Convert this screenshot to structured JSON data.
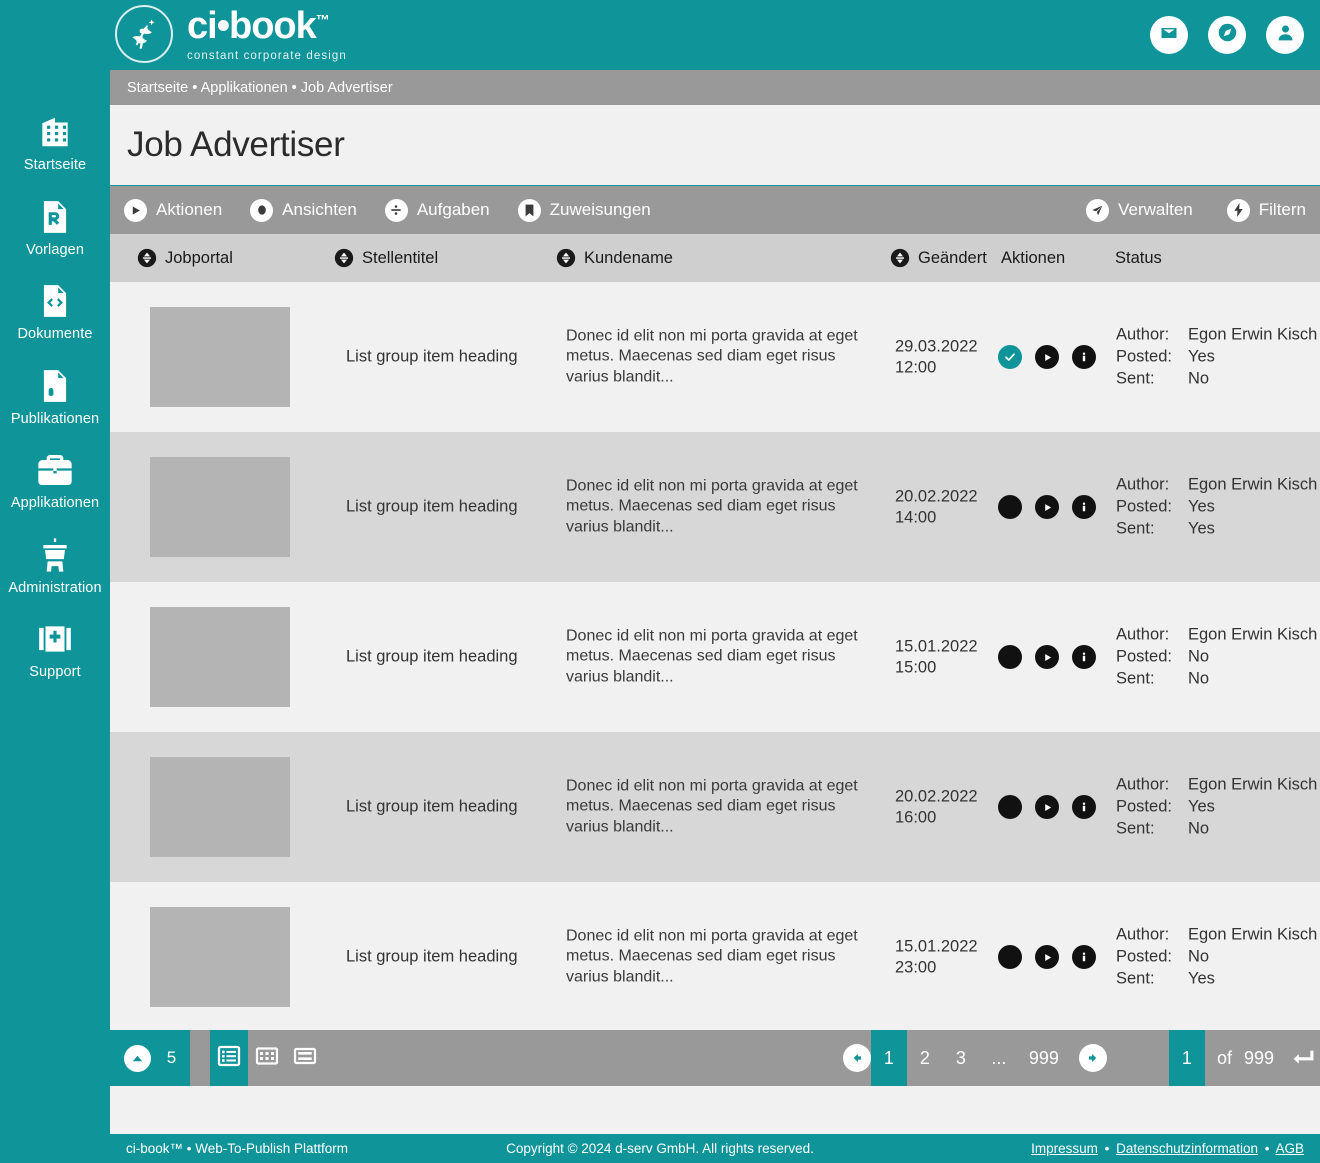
{
  "brand": {
    "logo_main": "ci•book",
    "logo_tm": "™",
    "logo_sub": "constant corporate design",
    "accent_color": "#0e9499",
    "toolbar_gray": "#999999",
    "header_gray": "#cfcfcf",
    "row_odd": "#f1f1f1",
    "row_even": "#d7d7d7",
    "thumb_color": "#b4b4b4"
  },
  "header": {
    "icons": [
      {
        "name": "mail-icon",
        "label": "Nachrichten"
      },
      {
        "name": "compass-icon",
        "label": "Navigation"
      },
      {
        "name": "user-icon",
        "label": "Benutzerkonto"
      }
    ]
  },
  "breadcrumb": {
    "text": "Startseite • Applikationen • Job Advertiser"
  },
  "page": {
    "title": "Job Advertiser"
  },
  "sidebar": {
    "items": [
      {
        "label": "Startseite",
        "icon": "building-icon"
      },
      {
        "label": "Vorlagen",
        "icon": "prescription-document-icon"
      },
      {
        "label": "Dokumente",
        "icon": "code-document-icon"
      },
      {
        "label": "Publikationen",
        "icon": "publication-document-icon"
      },
      {
        "label": "Applikationen",
        "icon": "toolbox-icon"
      },
      {
        "label": "Administration",
        "icon": "control-tower-icon"
      },
      {
        "label": "Support",
        "icon": "first-aid-icon"
      }
    ]
  },
  "toolbar": {
    "left": [
      {
        "label": "Aktionen",
        "icon": "play-circle-icon"
      },
      {
        "label": "Ansichten",
        "icon": "eye-circle-icon"
      },
      {
        "label": "Aufgaben",
        "icon": "divide-circle-icon"
      },
      {
        "label": "Zuweisungen",
        "icon": "bookmark-circle-icon"
      }
    ],
    "right": [
      {
        "label": "Verwalten",
        "icon": "paper-plane-circle-icon"
      },
      {
        "label": "Filtern",
        "icon": "bolt-circle-icon"
      }
    ]
  },
  "table": {
    "columns": [
      {
        "label": "Jobportal",
        "sortable": true
      },
      {
        "label": "Stellentitel",
        "sortable": true
      },
      {
        "label": "Kundename",
        "sortable": true
      },
      {
        "label": "Geändert",
        "sortable": true
      },
      {
        "label": "Aktionen",
        "sortable": false
      },
      {
        "label": "Status",
        "sortable": false
      }
    ],
    "status_labels": {
      "author": "Author:",
      "posted": "Posted:",
      "sent": "Sent:"
    },
    "rows": [
      {
        "title": "List group item heading",
        "description": "Donec id elit non mi porta gravida at eget metus. Maecenas sed diam eget risus varius blandit...",
        "date": "29.03.2022",
        "time": "12:00",
        "actions": [
          {
            "name": "check-circle-icon",
            "state": "done"
          },
          {
            "name": "play-circle-icon",
            "state": "normal"
          },
          {
            "name": "info-circle-icon",
            "state": "normal"
          }
        ],
        "author": "Egon Erwin Kisch",
        "posted": "Yes",
        "sent": "No"
      },
      {
        "title": "List group item heading",
        "description": "Donec id elit non mi porta gravida at eget metus. Maecenas sed diam eget risus varius blandit...",
        "date": "20.02.2022",
        "time": "14:00",
        "actions": [
          {
            "name": "circle-icon",
            "state": "normal"
          },
          {
            "name": "play-circle-icon",
            "state": "normal"
          },
          {
            "name": "info-circle-icon",
            "state": "normal"
          }
        ],
        "author": "Egon Erwin Kisch",
        "posted": "Yes",
        "sent": "Yes"
      },
      {
        "title": "List group item heading",
        "description": "Donec id elit non mi porta gravida at eget metus. Maecenas sed diam eget risus varius blandit...",
        "date": "15.01.2022",
        "time": "15:00",
        "actions": [
          {
            "name": "circle-icon",
            "state": "normal"
          },
          {
            "name": "play-circle-icon",
            "state": "normal"
          },
          {
            "name": "info-circle-icon",
            "state": "normal"
          }
        ],
        "author": "Egon Erwin Kisch",
        "posted": "No",
        "sent": "No"
      },
      {
        "title": "List group item heading",
        "description": "Donec id elit non mi porta gravida at eget metus. Maecenas sed diam eget risus varius blandit...",
        "date": "20.02.2022",
        "time": "16:00",
        "actions": [
          {
            "name": "circle-icon",
            "state": "normal"
          },
          {
            "name": "play-circle-icon",
            "state": "normal"
          },
          {
            "name": "info-circle-icon",
            "state": "normal"
          }
        ],
        "author": "Egon Erwin Kisch",
        "posted": "Yes",
        "sent": "No"
      },
      {
        "title": "List group item heading",
        "description": "Donec id elit non mi porta gravida at eget metus. Maecenas sed diam eget risus varius blandit...",
        "date": "15.01.2022",
        "time": "23:00",
        "actions": [
          {
            "name": "circle-icon",
            "state": "normal"
          },
          {
            "name": "play-circle-icon",
            "state": "normal"
          },
          {
            "name": "info-circle-icon",
            "state": "normal"
          }
        ],
        "author": "Egon Erwin Kisch",
        "posted": "No",
        "sent": "Yes"
      }
    ]
  },
  "pagination": {
    "per_page": "5",
    "views": [
      {
        "name": "list-view-icon",
        "active": true
      },
      {
        "name": "grid-view-icon",
        "active": false
      },
      {
        "name": "split-view-icon",
        "active": false
      }
    ],
    "prev_icon": "arrow-left-circle-icon",
    "next_icon": "arrow-right-circle-icon",
    "pages": [
      "1",
      "2",
      "3"
    ],
    "gap": "...",
    "last_page": "999",
    "current_page": "1",
    "of_label": "of",
    "total_pages": "999",
    "enter_icon": "enter-key-icon"
  },
  "footer": {
    "left": "ci-book™ • Web-To-Publish Plattform",
    "center": "Copyright © 2024 d-serv GmbH. All rights reserved.",
    "links": [
      {
        "label": "Impressum"
      },
      {
        "label": "Datenschutzinformation"
      },
      {
        "label": "AGB"
      }
    ],
    "link_separator": "•"
  }
}
